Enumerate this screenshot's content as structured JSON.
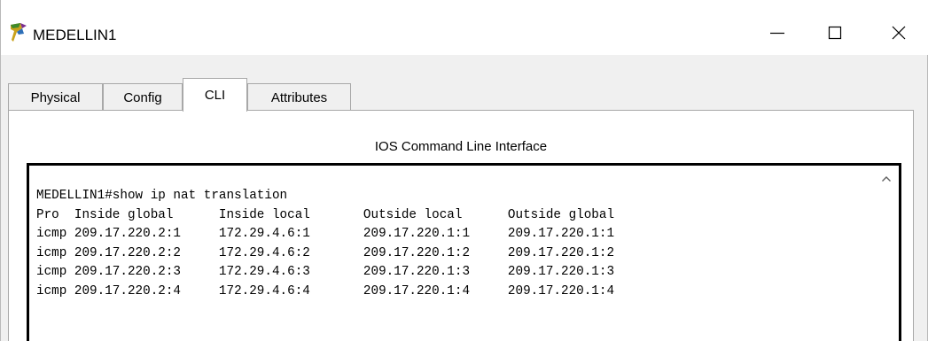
{
  "window": {
    "title": "MEDELLIN1",
    "icon": "router-icon"
  },
  "tabs": [
    {
      "label": "Physical"
    },
    {
      "label": "Config"
    },
    {
      "label": "CLI",
      "active": true
    },
    {
      "label": "Attributes"
    }
  ],
  "panel": {
    "title": "IOS Command Line Interface"
  },
  "console": {
    "lines": [
      "MEDELLIN1#show ip nat translation",
      "Pro  Inside global      Inside local       Outside local      Outside global",
      "icmp 209.17.220.2:1     172.29.4.6:1       209.17.220.1:1     209.17.220.1:1",
      "icmp 209.17.220.2:2     172.29.4.6:2       209.17.220.1:2     209.17.220.1:2",
      "icmp 209.17.220.2:3     172.29.4.6:3       209.17.220.1:3     209.17.220.1:3",
      "icmp 209.17.220.2:4     172.29.4.6:4       209.17.220.1:4     209.17.220.1:4"
    ]
  },
  "colors": {
    "titlebar_bg": "#ffffff",
    "window_bg": "#f0f0f0",
    "panel_bg": "#ffffff",
    "console_border": "#000000"
  }
}
